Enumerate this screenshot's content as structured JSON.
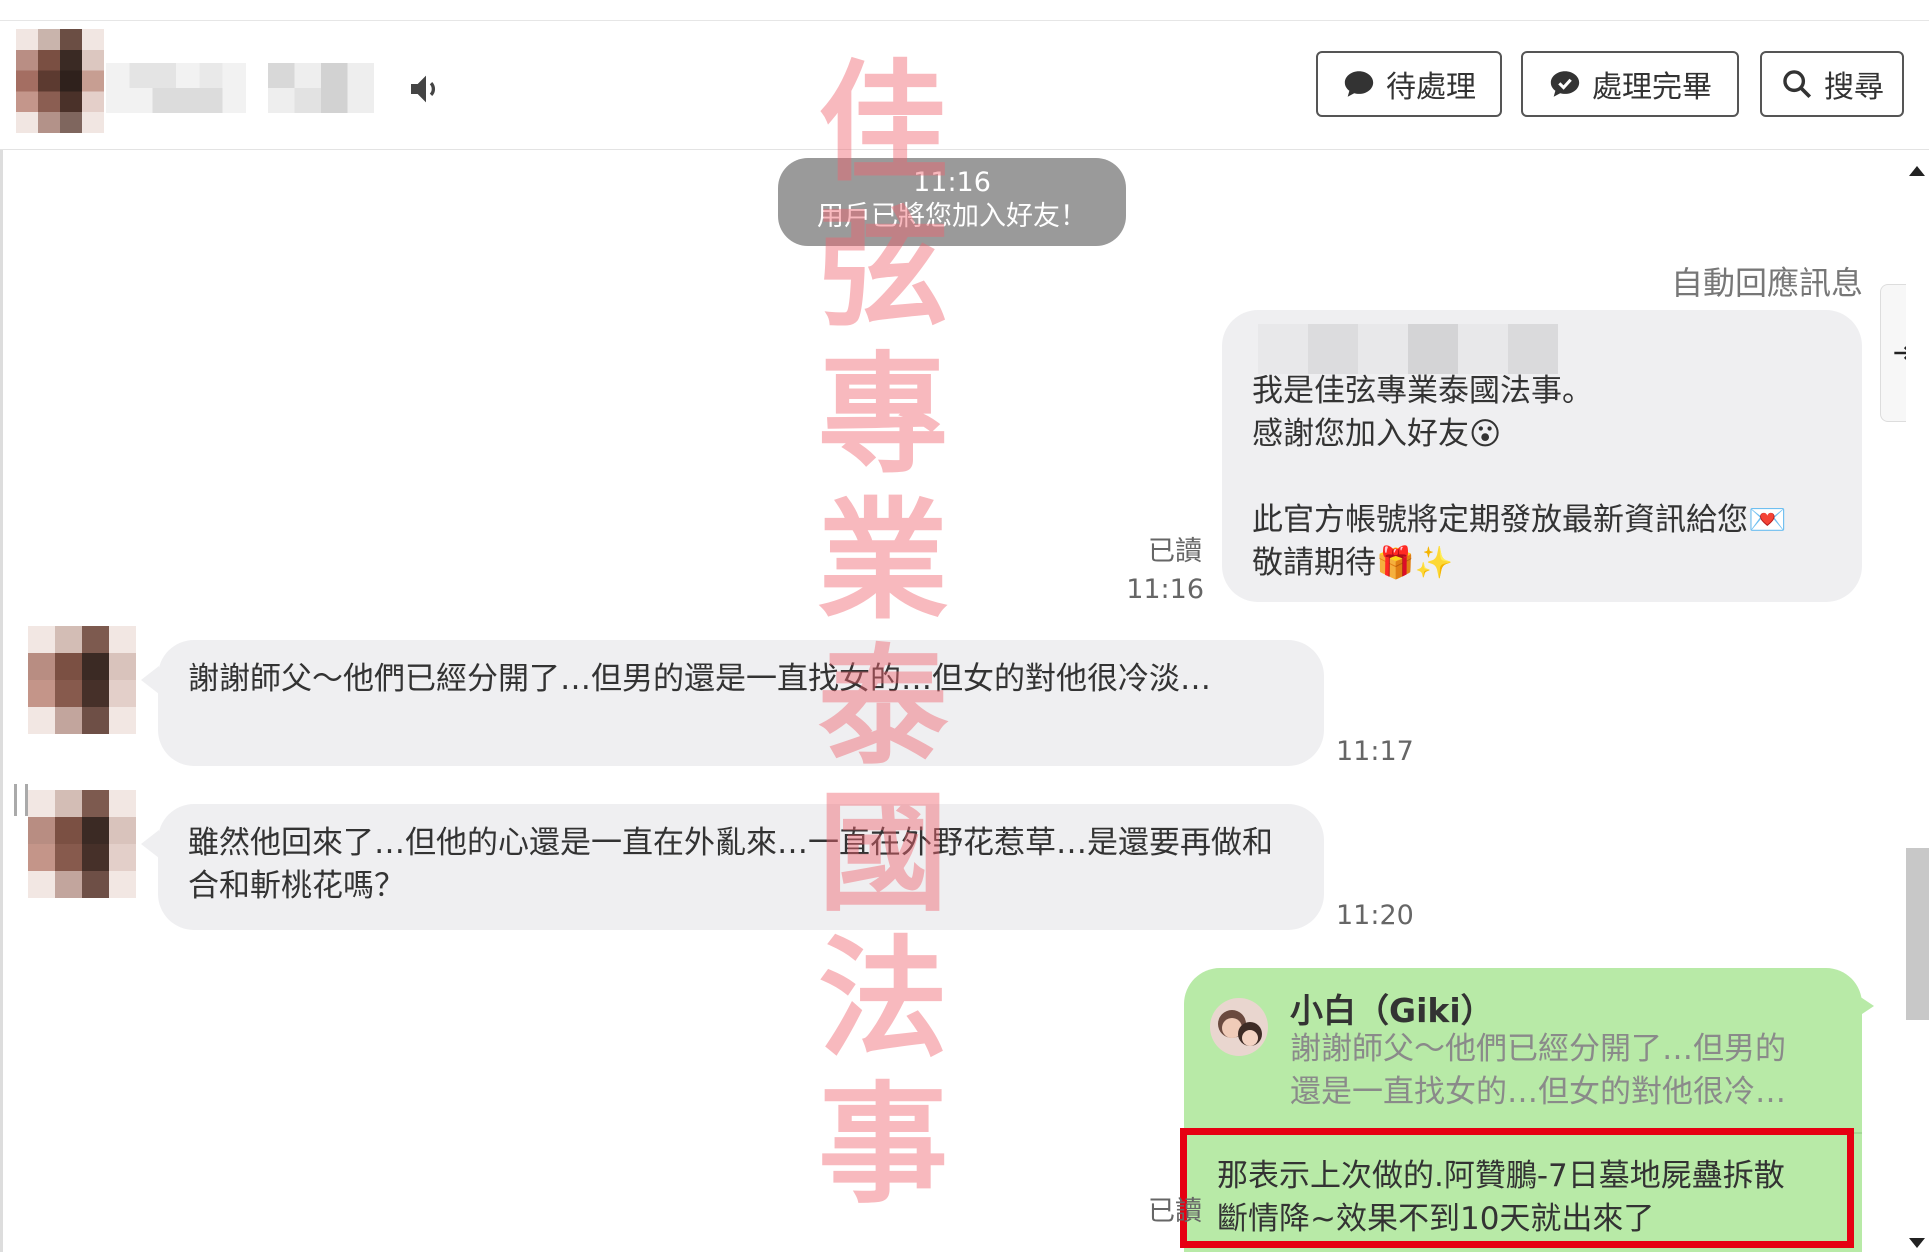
{
  "header": {
    "buttons": {
      "pending": "待處理",
      "done": "處理完畢",
      "search": "搜尋"
    }
  },
  "system": {
    "time": "11:16",
    "text": "用戶已將您加入好友！"
  },
  "auto_reply": {
    "label": "自動回應訊息",
    "body": "我是佳弦專業泰國法事。\n感謝您加入好友😮\n\n此官方帳號將定期發放最新資訊給您💌\n敬請期待🎁✨",
    "read": "已讀",
    "time": "11:16"
  },
  "messages_in": [
    {
      "text": "謝謝師父～他們已經分開了…但男的還是一直找女的…但女的對他很冷淡…",
      "time": "11:17"
    },
    {
      "text": "雖然他回來了…但他的心還是一直在外亂來…一直在外野花惹草…是還要再做和合和斬桃花嗎？",
      "time": "11:20"
    }
  ],
  "message_out": {
    "reply_name": "小白（Giki）",
    "reply_quote": "謝謝師父～他們已經分開了…但男的\n還是一直找女的…但女的對他很冷…",
    "text": "那表示上次做的.阿贊鵬-7日墓地屍蠱拆散\n斷情降~效果不到10天就出來了",
    "read": "已讀"
  },
  "watermark": "佳弦專業泰國法事",
  "colors": {
    "incoming_bubble": "#efeff1",
    "outgoing_bubble": "#b8eaa7",
    "highlight_border": "#e60012",
    "watermark": "#f0646e"
  }
}
